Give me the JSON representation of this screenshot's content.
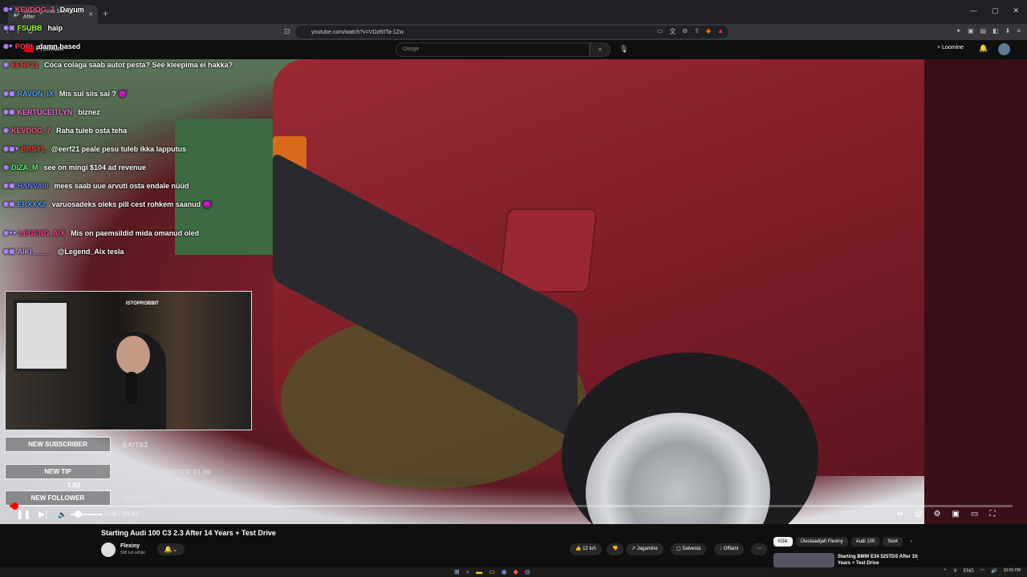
{
  "browser": {
    "tab_title": "Starting Audi 100 C2 2.3 After",
    "url": "youtube.com/watch?v=VDzRITa-1Zw"
  },
  "youtube": {
    "logo_label": "Premium",
    "search_placeholder": "Otsige",
    "create_label": "Loomine"
  },
  "chat": {
    "messages": [
      {
        "user": "KEVDOG_7",
        "text": "Dayum",
        "color": "#ff5a8a"
      },
      {
        "user": "FSUBB",
        "text": "haip",
        "color": "#9dff3a"
      },
      {
        "user": "PORI",
        "text": "damn based",
        "color": "#ff3a5a"
      },
      {
        "user": "EERF21",
        "text": "Coca colaga saab autot pesta? See kleepima ei hakka?",
        "color": "#ff4444"
      },
      {
        "user": "RAVON_IX",
        "text": "Mis sul siis sai ? 😈",
        "color": "#5aa0ff"
      },
      {
        "user": "KERTUCEITLYN",
        "text": "biznez",
        "color": "#ff6ad5"
      },
      {
        "user": "KEVDOG_7",
        "text": "Raha tuleb osta teha",
        "color": "#ff5a8a"
      },
      {
        "user": "BRSYL",
        "text": "@eerf21 peale pesu tuleb ikka lapputus",
        "color": "#ff3a3a"
      },
      {
        "user": "DIZA_M",
        "text": "see on mingi $104 ad revenue",
        "color": "#4aff6a"
      },
      {
        "user": "HANVAIII",
        "text": "mees saab uue arvuti osta endale nüüd",
        "color": "#6a7aff"
      },
      {
        "user": "ERXXXZ",
        "text": "varuosadeks oleks pill cest rohkem saanud 😈",
        "color": "#4a9aff"
      },
      {
        "user": "LEGEND_AIX",
        "text": "Mis on paemsildid mida omanud oled",
        "color": "#ff3a8a"
      },
      {
        "user": "AIKI_____",
        "text": "@Legend_Aix tesla",
        "color": "#b89aff"
      }
    ]
  },
  "webcam": {
    "sign": "ISTOPROBBIT"
  },
  "alerts": [
    {
      "label": "NEW SUBSCRIBER",
      "name": "KAITSZ"
    },
    {
      "label": "NEW TIP",
      "name": "RÄPANEREPORTER €3.00"
    },
    {
      "label": "NEW FOLLOWER",
      "name": "WBABBZZ"
    }
  ],
  "player": {
    "preview_time": "1:03",
    "time_display": "0:08 / 29:47",
    "progress_fraction": 0.0045
  },
  "video": {
    "title": "Starting Audi 100 C3 2.3 After 14 Years + Test Drive",
    "channel": "Flexiny",
    "subscribers": "588 tuh tellijat",
    "likes": "12 tuh",
    "share_label": "Jagamine",
    "save_label": "Salvesta",
    "offline_label": "Offlaini"
  },
  "chips": [
    "Kõik",
    "Üleslaadijalt Flexiny",
    "Audi 100",
    "Seot"
  ],
  "recommendation": {
    "title": "Starting BMW E34 525TDS After 10 Years + Test Drive"
  },
  "taskbar": {
    "lang": "ENG",
    "time": "10:06 PM"
  }
}
